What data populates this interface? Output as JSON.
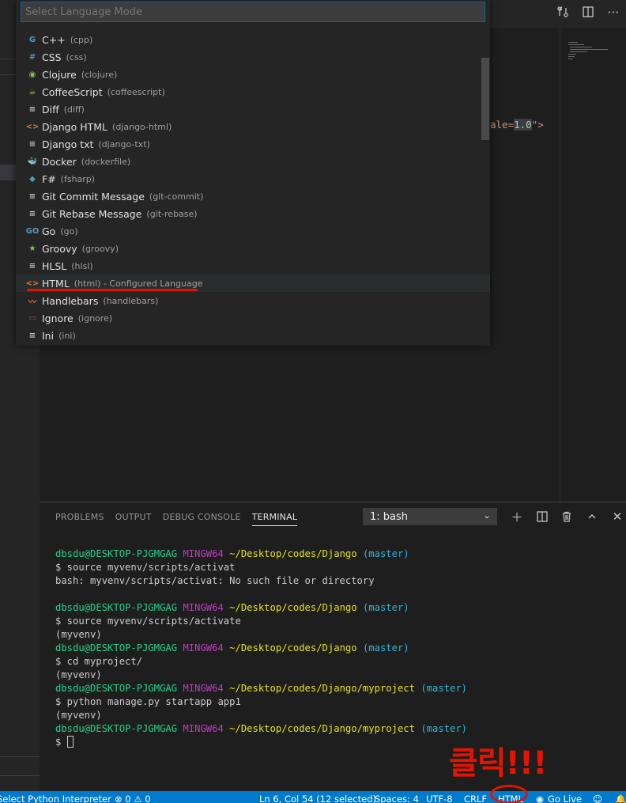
{
  "quickpick": {
    "placeholder": "Select Language Mode",
    "items": [
      {
        "label": "C++",
        "desc": "(cpp)",
        "icon": "cpp-icon",
        "glyph": "G",
        "color": "#519aba"
      },
      {
        "label": "CSS",
        "desc": "(css)",
        "icon": "css-icon",
        "glyph": "#",
        "color": "#519aba"
      },
      {
        "label": "Clojure",
        "desc": "(clojure)",
        "icon": "clojure-icon",
        "glyph": "◉",
        "color": "#8dc149"
      },
      {
        "label": "CoffeeScript",
        "desc": "(coffeescript)",
        "icon": "coffeescript-icon",
        "glyph": "☕",
        "color": "#cbcb41"
      },
      {
        "label": "Diff",
        "desc": "(diff)",
        "icon": "file-lines-icon",
        "glyph": "≡",
        "color": "#cccccc"
      },
      {
        "label": "Django HTML",
        "desc": "(django-html)",
        "icon": "html-brackets-icon",
        "glyph": "<>",
        "color": "#e37933"
      },
      {
        "label": "Django txt",
        "desc": "(django-txt)",
        "icon": "file-lines-icon",
        "glyph": "≡",
        "color": "#cccccc"
      },
      {
        "label": "Docker",
        "desc": "(dockerfile)",
        "icon": "docker-icon",
        "glyph": "🐳",
        "color": "#519aba"
      },
      {
        "label": "F#",
        "desc": "(fsharp)",
        "icon": "fsharp-icon",
        "glyph": "◆",
        "color": "#519aba"
      },
      {
        "label": "Git Commit Message",
        "desc": "(git-commit)",
        "icon": "file-lines-icon",
        "glyph": "≡",
        "color": "#cccccc"
      },
      {
        "label": "Git Rebase Message",
        "desc": "(git-rebase)",
        "icon": "file-lines-icon",
        "glyph": "≡",
        "color": "#cccccc"
      },
      {
        "label": "Go",
        "desc": "(go)",
        "icon": "go-icon",
        "glyph": "GO",
        "color": "#519aba"
      },
      {
        "label": "Groovy",
        "desc": "(groovy)",
        "icon": "groovy-icon",
        "glyph": "★",
        "color": "#8dc149"
      },
      {
        "label": "HLSL",
        "desc": "(hlsl)",
        "icon": "file-lines-icon",
        "glyph": "≡",
        "color": "#cccccc"
      },
      {
        "label": "HTML",
        "desc": "(html) - Configured Language",
        "icon": "html-brackets-icon",
        "glyph": "<>",
        "color": "#e37933"
      },
      {
        "label": "Handlebars",
        "desc": "(handlebars)",
        "icon": "handlebars-icon",
        "glyph": "〰",
        "color": "#e37933"
      },
      {
        "label": "Ignore",
        "desc": "(ignore)",
        "icon": "ignore-icon",
        "glyph": "▭",
        "color": "#cc3e44"
      },
      {
        "label": "Ini",
        "desc": "(ini)",
        "icon": "file-lines-icon",
        "glyph": "≡",
        "color": "#cccccc"
      }
    ]
  },
  "editor": {
    "code_prefix": "ale=",
    "code_value": "1.0",
    "code_suffix": "\">"
  },
  "panel": {
    "tabs": [
      "PROBLEMS",
      "OUTPUT",
      "DEBUG CONSOLE",
      "TERMINAL"
    ],
    "active_tab": "TERMINAL",
    "terminal_select": "1: bash"
  },
  "terminal": {
    "user": "dbsdu@DESKTOP-PJGMGAG",
    "host": "MINGW64",
    "path1": "~/Desktop/codes/Django",
    "path2": "~/Desktop/codes/Django/myproject",
    "branch": "(master)",
    "cmd1": "$ source myvenv/scripts/activat",
    "err1": "bash: myvenv/scripts/activat: No such file or directory",
    "cmd2": "$ source myvenv/scripts/activate",
    "venv": "(myvenv)",
    "cmd3": "$ cd myproject/",
    "cmd4": "$ python manage.py startapp app1",
    "prompt": "$ "
  },
  "annotation": {
    "korean": "클릭!!!"
  },
  "statusbar": {
    "interpreter": "Select Python Interpreter",
    "problems": "⊗ 0 ⚠ 0",
    "position": "Ln 6, Col 54 (12 selected)",
    "spaces": "Spaces: 4",
    "encoding": "UTF-8",
    "eol": "CRLF",
    "language": "HTML",
    "golive": "Go Live"
  },
  "colors": {
    "accent": "#007acc",
    "annotation_red": "#e51400"
  }
}
